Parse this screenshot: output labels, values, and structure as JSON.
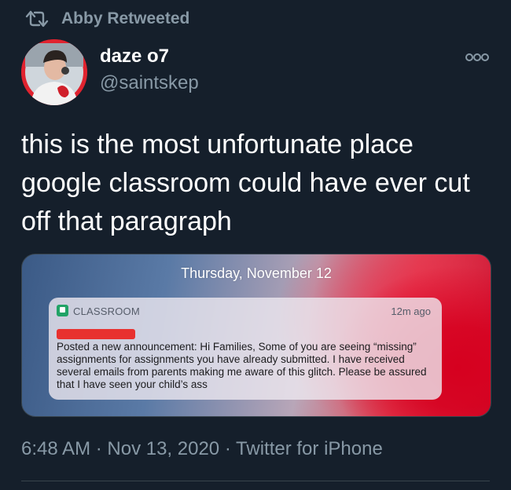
{
  "retweet": {
    "icon": "retweet-icon",
    "label": "Abby Retweeted"
  },
  "author": {
    "display_name": "daze o7",
    "handle": "@saintskep",
    "avatar": "avatar-photo"
  },
  "more_icon": "more-options-icon",
  "tweet": {
    "text": "this is the most unfortunate place google classroom could have ever cut off that paragraph"
  },
  "media": {
    "date": "Thursday, November 12",
    "notification": {
      "app_icon": "google-classroom-icon",
      "app_name": "CLASSROOM",
      "time": "12m ago",
      "body": "Posted a new announcement: Hi Families, Some of you are seeing “missing” assignments for assignments you have already submitted. I have received several emails from parents making me aware of this glitch. Please be assured that I have seen your child’s ass"
    }
  },
  "meta": {
    "timestamp": "6:48 AM · Nov 13, 2020 · Twitter for iPhone"
  },
  "colors": {
    "background": "#151f2b",
    "secondary_text": "#8899a6",
    "avatar_ring": "#e0232f"
  }
}
